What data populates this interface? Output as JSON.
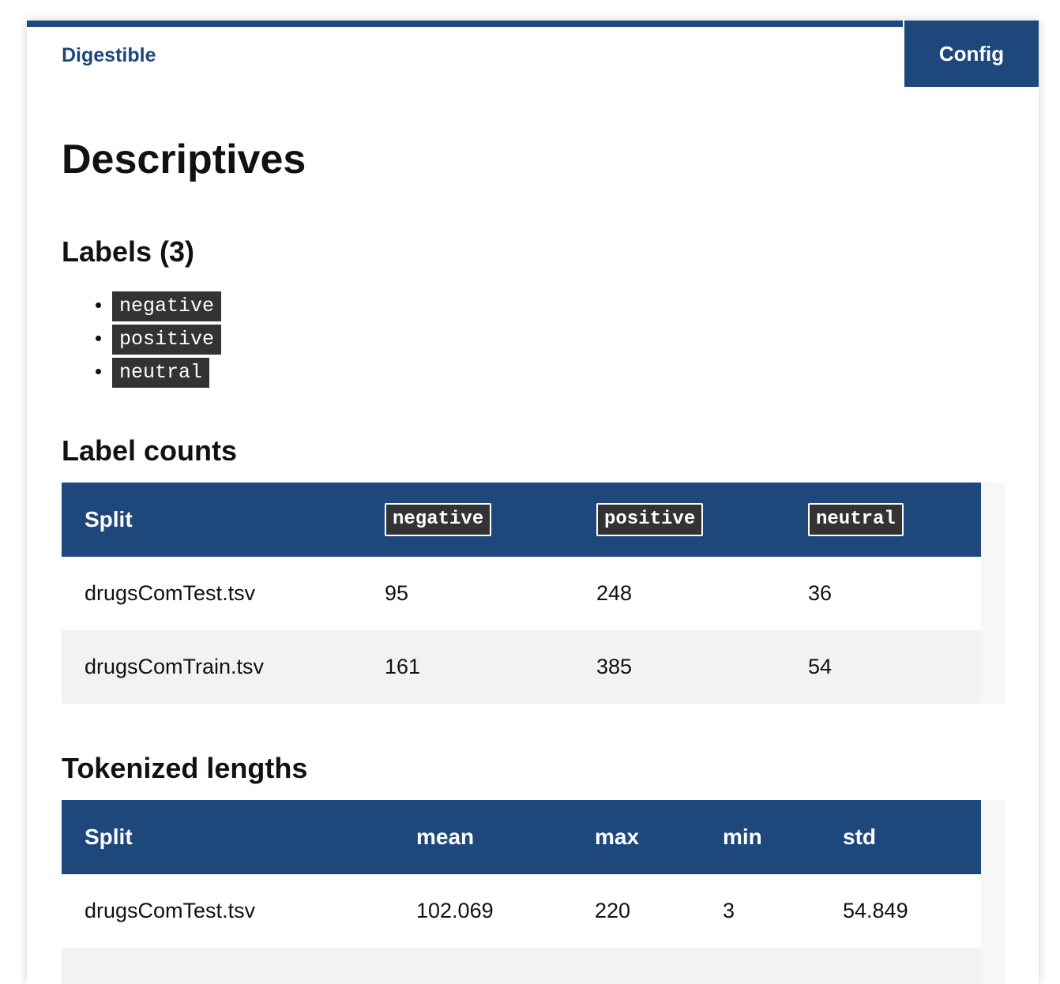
{
  "nav": {
    "brand": "Digestible",
    "config_label": "Config"
  },
  "page_title": "Descriptives",
  "labels_section": {
    "heading": "Labels (3)",
    "items": [
      "negative",
      "positive",
      "neutral"
    ]
  },
  "label_counts": {
    "heading": "Label counts",
    "columns": [
      "Split",
      "negative",
      "positive",
      "neutral"
    ],
    "rows": [
      [
        "drugsComTest.tsv",
        "95",
        "248",
        "36"
      ],
      [
        "drugsComTrain.tsv",
        "161",
        "385",
        "54"
      ]
    ]
  },
  "tokenized_lengths": {
    "heading": "Tokenized lengths",
    "columns": [
      "Split",
      "mean",
      "max",
      "min",
      "std"
    ],
    "rows": [
      [
        "drugsComTest.tsv",
        "102.069",
        "220",
        "3",
        "54.849"
      ]
    ]
  },
  "colors": {
    "accent": "#1e477c",
    "tag_bg": "#333333"
  }
}
